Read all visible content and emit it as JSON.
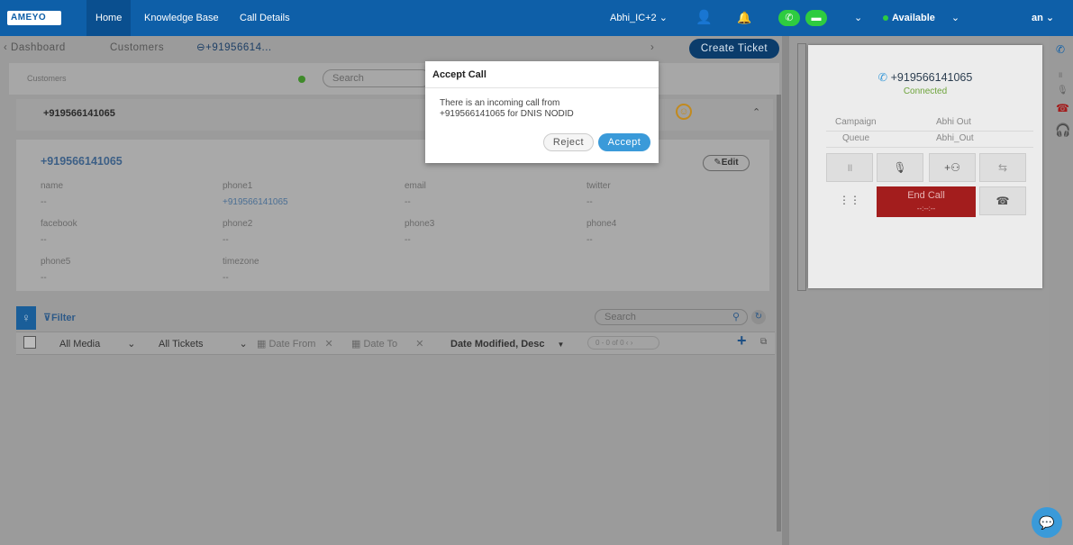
{
  "topbar": {
    "logo": "AMEYO",
    "nav": [
      "Home",
      "Knowledge Base",
      "Call Details"
    ],
    "campaign": "Abhi_IC+2",
    "status": "Available",
    "user": "an"
  },
  "tabs": {
    "dashboard": "Dashboard",
    "customers": "Customers",
    "active": "+91956614...",
    "create_ticket": "Create Ticket"
  },
  "breadcrumb": "Customers",
  "search_placeholder": "Search",
  "customer": {
    "header_number": "+919566141065",
    "title_number": "+919566141065",
    "edit_label": "Edit",
    "fields": [
      {
        "label": "name",
        "value": "--"
      },
      {
        "label": "phone1",
        "value": "+919566141065"
      },
      {
        "label": "email",
        "value": "--"
      },
      {
        "label": "twitter",
        "value": "--"
      },
      {
        "label": "facebook",
        "value": "--"
      },
      {
        "label": "phone2",
        "value": "--"
      },
      {
        "label": "phone3",
        "value": "--"
      },
      {
        "label": "phone4",
        "value": "--"
      },
      {
        "label": "phone5",
        "value": "--"
      },
      {
        "label": "timezone",
        "value": "--"
      }
    ]
  },
  "filters": {
    "filter_label": "Filter",
    "search_placeholder": "Search",
    "media": "All Media",
    "tickets": "All Tickets",
    "date_from": "Date From",
    "date_to": "Date To",
    "sort": "Date Modified, Desc",
    "pager": "0 - 0 of 0"
  },
  "call": {
    "number": "+919566141065",
    "status": "Connected",
    "campaign_label": "Campaign",
    "campaign_value": "Abhi Out",
    "queue_label": "Queue",
    "queue_value": "Abhi_Out",
    "end_call_label": "End Call",
    "end_call_timer": "--:--:--"
  },
  "modal": {
    "title": "Accept Call",
    "line1": "There is an incoming call from",
    "line2": "+919566141065 for DNIS NODID",
    "reject": "Reject",
    "accept": "Accept"
  },
  "colors": {
    "brand": "#0e5fa8",
    "accept": "#3a9ad9",
    "end_call": "#a31d1d",
    "available": "#2ecc40"
  }
}
